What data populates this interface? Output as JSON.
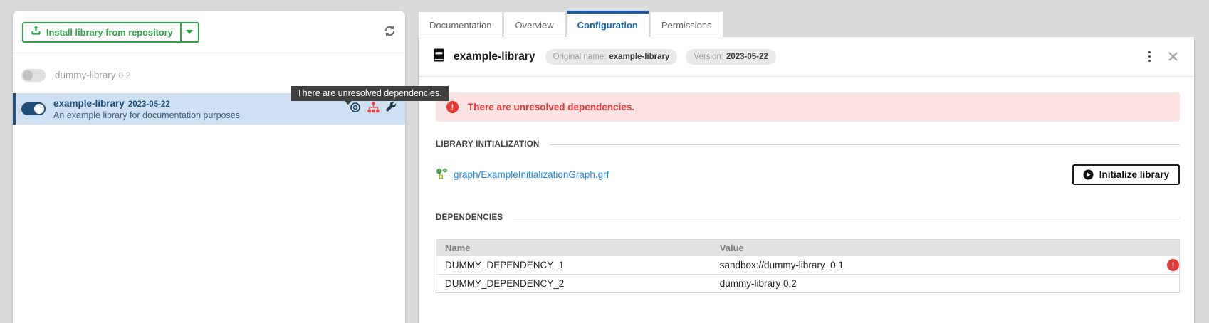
{
  "colors": {
    "page_bg": "#dadada",
    "green": "#28a745",
    "navy": "#1f4e79",
    "tab_active_blue": "#1466bd",
    "tab_bar_blue": "#1d5b9e",
    "error_red": "#e53935",
    "value_error_red": "#ef5350",
    "link_blue": "#1e88e5",
    "selected_row_bg": "#cee0f1",
    "alert_bg": "#fbe3e3"
  },
  "left_panel": {
    "install_button": {
      "label": "Install library from repository"
    },
    "libraries": [
      {
        "name": "dummy-library",
        "version": "0.2",
        "enabled": false
      },
      {
        "name": "example-library",
        "version": "2023-05-22",
        "description": "An example library for documentation purposes",
        "enabled": true,
        "selected": true
      }
    ]
  },
  "tooltip": {
    "text": "There are unresolved dependencies."
  },
  "tabs": [
    {
      "label": "Documentation",
      "active": false
    },
    {
      "label": "Overview",
      "active": false
    },
    {
      "label": "Configuration",
      "active": true
    },
    {
      "label": "Permissions",
      "active": false
    }
  ],
  "detail": {
    "title": "example-library",
    "original_name_label": "Original name:",
    "original_name": "example-library",
    "version_label": "Version:",
    "version": "2023-05-22",
    "alert_message": "There are unresolved dependencies.",
    "initialization": {
      "section_label": "LIBRARY INITIALIZATION",
      "graph_link": "graph/ExampleInitializationGraph.grf",
      "button_label": "Initialize library"
    },
    "dependencies": {
      "section_label": "DEPENDENCIES",
      "headers": {
        "name": "Name",
        "value": "Value"
      },
      "rows": [
        {
          "name": "DUMMY_DEPENDENCY_1",
          "value": "sandbox://dummy-library_0.1",
          "error": "!"
        },
        {
          "name": "DUMMY_DEPENDENCY_2",
          "value": "dummy-library 0.2",
          "error": ""
        }
      ]
    }
  }
}
